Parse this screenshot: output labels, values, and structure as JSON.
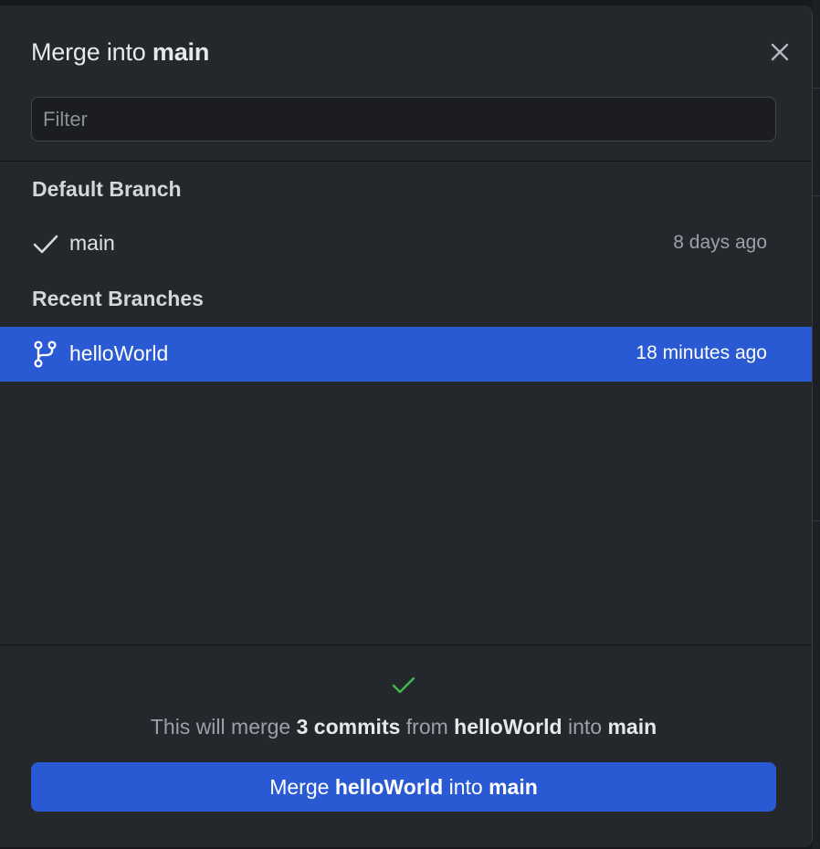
{
  "dialog": {
    "title_prefix": "Merge into",
    "title_branch": "main",
    "filter_placeholder": "Filter",
    "filter_value": ""
  },
  "default_branch": {
    "heading": "Default Branch",
    "name": "main",
    "time": "8 days ago",
    "icon": "checkmark-icon"
  },
  "recent_branches": {
    "heading": "Recent Branches",
    "items": [
      {
        "name": "helloWorld",
        "time": "18 minutes ago",
        "icon": "git-branch-icon",
        "selected": true
      }
    ]
  },
  "summary": {
    "icon": "success-check-icon",
    "prefix": "This will merge",
    "count": "3 commits",
    "from_word": "from",
    "source": "helloWorld",
    "into_word": "into",
    "target": "main"
  },
  "merge_button": {
    "prefix": "Merge",
    "source": "helloWorld",
    "into_word": "into",
    "target": "main"
  },
  "colors": {
    "accent": "#2a5ad3",
    "background": "#24272c",
    "success": "#3fb950"
  }
}
